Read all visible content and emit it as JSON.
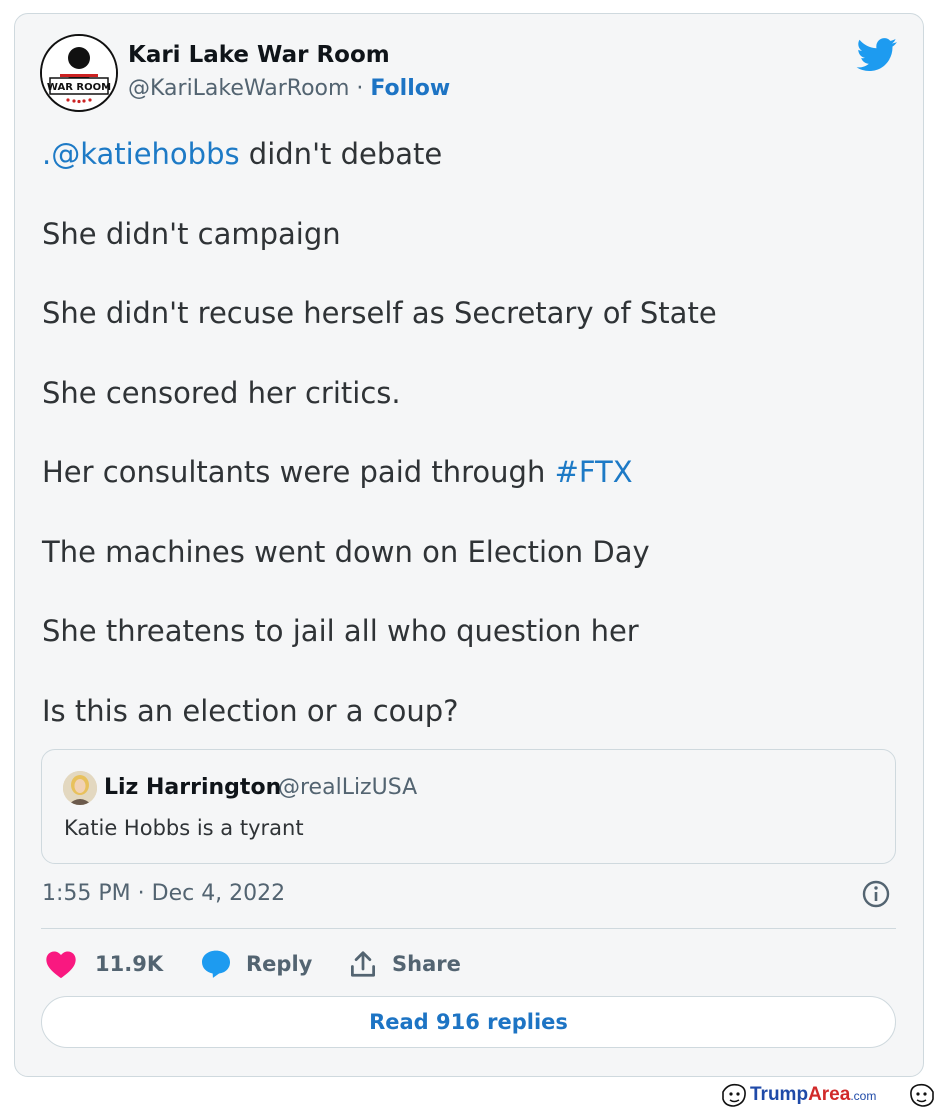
{
  "author": {
    "name": "Kari Lake War Room",
    "handle": "@KariLakeWarRoom",
    "separator": " · ",
    "follow_label": "Follow",
    "avatar_text": "WAR ROOM"
  },
  "tweet": {
    "line1_link": ".@katiehobbs",
    "line1_rest": " didn't debate",
    "line2": "She didn't campaign",
    "line3": "She didn't recuse herself as Secretary of State",
    "line4": "She censored her critics.",
    "line5_text": "Her consultants were paid through ",
    "line5_hashtag": "#FTX",
    "line6": "The machines went down on Election Day",
    "line7": "She threatens to jail all who question her",
    "line8": "Is this an election or a coup?"
  },
  "quote": {
    "name": "Liz Harrington",
    "handle": "@realLizUSA",
    "text": "Katie Hobbs is a tyrant"
  },
  "timestamp": "1:55 PM · Dec 4, 2022",
  "actions": {
    "like_count": "11.9K",
    "reply_label": "Reply",
    "share_label": "Share"
  },
  "read_replies_label": "Read 916 replies",
  "watermark": {
    "part1": "Trump",
    "part2": "Area",
    "part3": ".com"
  },
  "colors": {
    "link": "#1d7ac6",
    "like": "#f91880",
    "reply": "#1d9bf0",
    "twitter": "#1d9bf0"
  }
}
